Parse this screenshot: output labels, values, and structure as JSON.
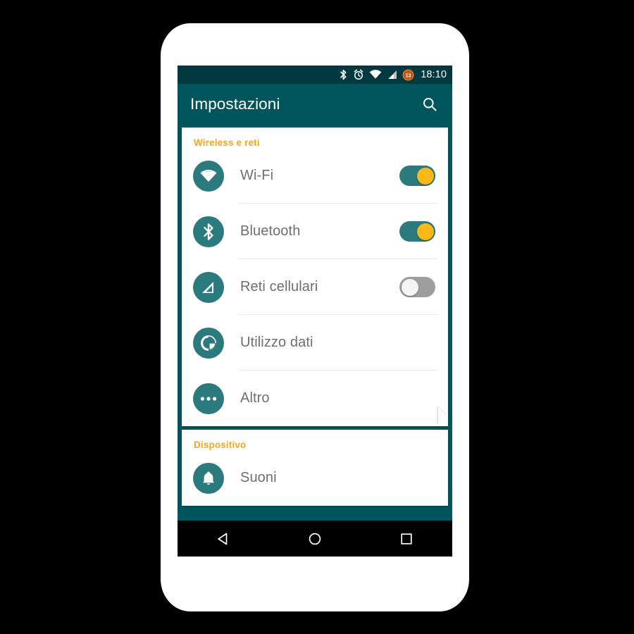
{
  "device": {
    "frame_color": "#ffffff",
    "background_color": "#000000"
  },
  "status_bar": {
    "background_color": "#003a40",
    "clock": "18:10",
    "battery_level": "13",
    "icons": [
      "bluetooth-icon",
      "alarm-clock-icon",
      "wifi-icon",
      "cellular-signal-icon",
      "battery-icon"
    ]
  },
  "app_bar": {
    "title": "Impostazioni",
    "background_color": "#00555c",
    "search_icon": "search-icon"
  },
  "accent_colors": {
    "section_header": "#f5a623",
    "icon_circle": "#2b7a7e",
    "toggle_on_track": "#2b7a7e",
    "toggle_on_knob": "#fcb814",
    "toggle_off_track": "#9e9e9e"
  },
  "sections": [
    {
      "header": "Wireless e reti",
      "rows": [
        {
          "label": "Wi-Fi",
          "icon": "wifi-icon",
          "toggle": "on"
        },
        {
          "label": "Bluetooth",
          "icon": "bluetooth-icon",
          "toggle": "on"
        },
        {
          "label": "Reti cellulari",
          "icon": "cellular-signal-icon",
          "toggle": "off"
        },
        {
          "label": "Utilizzo dati",
          "icon": "data-usage-icon",
          "toggle": null
        },
        {
          "label": "Altro",
          "icon": "more-horizontal-icon",
          "toggle": null
        }
      ]
    },
    {
      "header": "Dispositivo",
      "rows": [
        {
          "label": "Suoni",
          "icon": "bell-icon",
          "toggle": null
        }
      ]
    }
  ],
  "nav_bar": {
    "background_color": "#000000",
    "buttons": [
      {
        "name": "back-button",
        "icon": "triangle-left-icon"
      },
      {
        "name": "home-button",
        "icon": "circle-icon"
      },
      {
        "name": "recents-button",
        "icon": "square-icon"
      }
    ]
  }
}
